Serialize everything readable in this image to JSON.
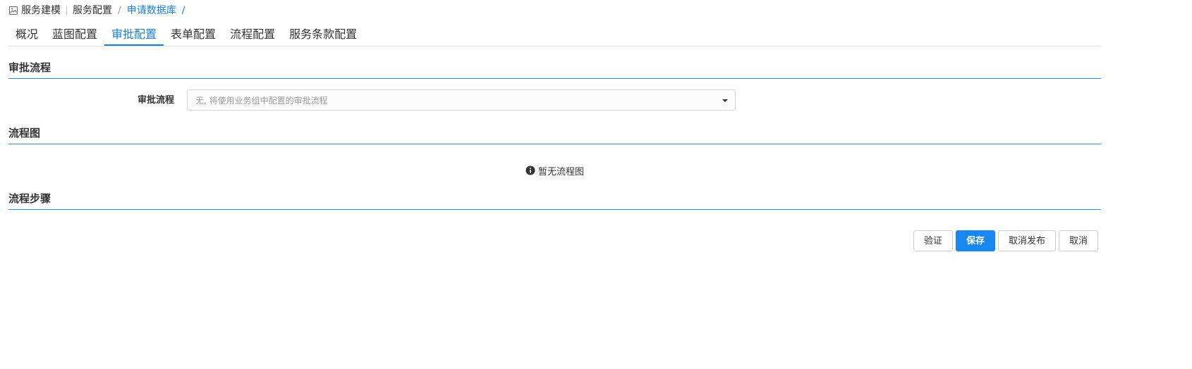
{
  "breadcrumb": {
    "icon": "image-icon",
    "items": [
      "服务建模",
      "服务配置",
      "申请数据库"
    ],
    "separator": "/"
  },
  "tabs": [
    {
      "label": "概况",
      "active": false
    },
    {
      "label": "蓝图配置",
      "active": false
    },
    {
      "label": "审批配置",
      "active": true
    },
    {
      "label": "表单配置",
      "active": false
    },
    {
      "label": "流程配置",
      "active": false
    },
    {
      "label": "服务条款配置",
      "active": false
    }
  ],
  "sections": {
    "approval": {
      "title": "审批流程",
      "field_label": "审批流程",
      "select_placeholder": "无, 将使用业务组中配置的审批流程"
    },
    "flowchart": {
      "title": "流程图",
      "empty_text": "暂无流程图"
    },
    "steps": {
      "title": "流程步骤"
    }
  },
  "actions": {
    "verify": "验证",
    "save": "保存",
    "unpublish": "取消发布",
    "cancel": "取消"
  },
  "colors": {
    "accent": "#1a7fd9",
    "primary_button": "#1a86f0"
  }
}
